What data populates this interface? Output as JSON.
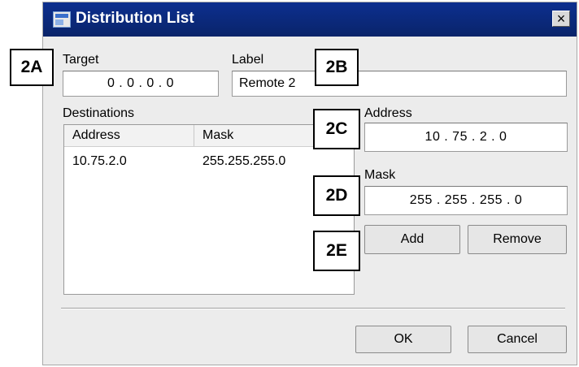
{
  "dialog": {
    "title": "Distribution List",
    "close_label": "×"
  },
  "target": {
    "label": "Target",
    "value": "0 . 0 . 0 . 0"
  },
  "label_field": {
    "label": "Label",
    "value": "Remote 2"
  },
  "destinations": {
    "label": "Destinations",
    "columns": [
      "Address",
      "Mask"
    ],
    "rows": [
      {
        "address": "10.75.2.0",
        "mask": "255.255.255.0"
      }
    ]
  },
  "address": {
    "label": "Address",
    "value": "10 . 75 . 2 . 0"
  },
  "mask": {
    "label": "Mask",
    "value": "255 . 255 . 255 . 0"
  },
  "buttons": {
    "add": "Add",
    "remove": "Remove",
    "ok": "OK",
    "cancel": "Cancel"
  },
  "callouts": [
    "2A",
    "2B",
    "2C",
    "2D",
    "2E"
  ]
}
